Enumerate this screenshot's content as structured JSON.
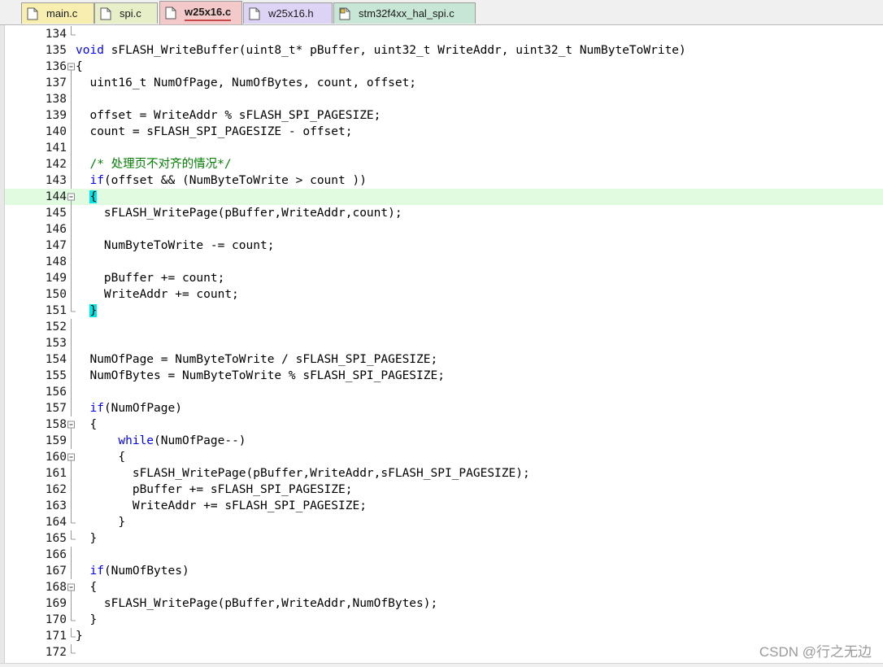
{
  "tabs": [
    {
      "label": "main.c",
      "color": "#f7eeb0",
      "icon": "c-file-icon",
      "active": false
    },
    {
      "label": "spi.c",
      "color": "#e6efc8",
      "icon": "c-file-icon",
      "active": false
    },
    {
      "label": "w25x16.c",
      "color": "#f4c9c9",
      "icon": "c-file-icon",
      "active": true
    },
    {
      "label": "w25x16.h",
      "color": "#ddd4f5",
      "icon": "h-file-icon",
      "active": false
    },
    {
      "label": "stm32f4xx_hal_spi.c",
      "color": "#c8e6d6",
      "icon": "c-file-key-icon",
      "active": false
    }
  ],
  "highlight_color": "#e0fbe0",
  "brace_match_color": "#00e5e5",
  "lines": [
    {
      "n": "134",
      "fold": "end",
      "segs": [
        {
          "t": ""
        }
      ]
    },
    {
      "n": "135",
      "fold": "",
      "segs": [
        {
          "t": "void",
          "c": "kw"
        },
        {
          "t": " sFLASH_WriteBuffer(uint8_t* pBuffer, uint32_t WriteAddr, uint32_t NumByteToWrite)"
        }
      ]
    },
    {
      "n": "136",
      "fold": "box",
      "segs": [
        {
          "t": "{"
        }
      ]
    },
    {
      "n": "137",
      "fold": "bar",
      "segs": [
        {
          "t": "  uint16_t NumOfPage, NumOfBytes, count, offset;"
        }
      ]
    },
    {
      "n": "138",
      "fold": "bar",
      "segs": [
        {
          "t": ""
        }
      ]
    },
    {
      "n": "139",
      "fold": "bar",
      "segs": [
        {
          "t": "  offset = WriteAddr % sFLASH_SPI_PAGESIZE;"
        }
      ]
    },
    {
      "n": "140",
      "fold": "bar",
      "segs": [
        {
          "t": "  count = sFLASH_SPI_PAGESIZE - offset;"
        }
      ]
    },
    {
      "n": "141",
      "fold": "bar",
      "segs": [
        {
          "t": ""
        }
      ]
    },
    {
      "n": "142",
      "fold": "bar",
      "segs": [
        {
          "t": "  "
        },
        {
          "t": "/* 处理页不对齐的情况*/",
          "c": "cm"
        }
      ]
    },
    {
      "n": "143",
      "fold": "bar",
      "segs": [
        {
          "t": "  "
        },
        {
          "t": "if",
          "c": "kw"
        },
        {
          "t": "(offset && (NumByteToWrite > count ))"
        }
      ]
    },
    {
      "n": "144",
      "fold": "box",
      "hl": true,
      "segs": [
        {
          "t": "  "
        },
        {
          "t": "{",
          "c": "br"
        }
      ]
    },
    {
      "n": "145",
      "fold": "bar",
      "segs": [
        {
          "t": "    sFLASH_WritePage(pBuffer,WriteAddr,count);"
        }
      ]
    },
    {
      "n": "146",
      "fold": "bar",
      "segs": [
        {
          "t": ""
        }
      ]
    },
    {
      "n": "147",
      "fold": "bar",
      "segs": [
        {
          "t": "    NumByteToWrite -= count;"
        }
      ]
    },
    {
      "n": "148",
      "fold": "bar",
      "segs": [
        {
          "t": ""
        }
      ]
    },
    {
      "n": "149",
      "fold": "bar",
      "segs": [
        {
          "t": "    pBuffer += count;"
        }
      ]
    },
    {
      "n": "150",
      "fold": "bar",
      "segs": [
        {
          "t": "    WriteAddr += count;"
        }
      ]
    },
    {
      "n": "151",
      "fold": "end",
      "segs": [
        {
          "t": "  "
        },
        {
          "t": "}",
          "c": "br"
        }
      ]
    },
    {
      "n": "152",
      "fold": "bar",
      "segs": [
        {
          "t": ""
        }
      ]
    },
    {
      "n": "153",
      "fold": "bar",
      "segs": [
        {
          "t": ""
        }
      ]
    },
    {
      "n": "154",
      "fold": "bar",
      "segs": [
        {
          "t": "  NumOfPage = NumByteToWrite / sFLASH_SPI_PAGESIZE;"
        }
      ]
    },
    {
      "n": "155",
      "fold": "bar",
      "segs": [
        {
          "t": "  NumOfBytes = NumByteToWrite % sFLASH_SPI_PAGESIZE;"
        }
      ]
    },
    {
      "n": "156",
      "fold": "bar",
      "segs": [
        {
          "t": ""
        }
      ]
    },
    {
      "n": "157",
      "fold": "bar",
      "segs": [
        {
          "t": "  "
        },
        {
          "t": "if",
          "c": "kw"
        },
        {
          "t": "(NumOfPage)"
        }
      ]
    },
    {
      "n": "158",
      "fold": "box",
      "segs": [
        {
          "t": "  {"
        }
      ]
    },
    {
      "n": "159",
      "fold": "bar",
      "segs": [
        {
          "t": "      "
        },
        {
          "t": "while",
          "c": "kw"
        },
        {
          "t": "(NumOfPage--)"
        }
      ]
    },
    {
      "n": "160",
      "fold": "box",
      "segs": [
        {
          "t": "      {"
        }
      ]
    },
    {
      "n": "161",
      "fold": "bar",
      "segs": [
        {
          "t": "        sFLASH_WritePage(pBuffer,WriteAddr,sFLASH_SPI_PAGESIZE);"
        }
      ]
    },
    {
      "n": "162",
      "fold": "bar",
      "segs": [
        {
          "t": "        pBuffer += sFLASH_SPI_PAGESIZE;"
        }
      ]
    },
    {
      "n": "163",
      "fold": "bar",
      "segs": [
        {
          "t": "        WriteAddr += sFLASH_SPI_PAGESIZE;"
        }
      ]
    },
    {
      "n": "164",
      "fold": "end",
      "segs": [
        {
          "t": "      }"
        }
      ]
    },
    {
      "n": "165",
      "fold": "end",
      "segs": [
        {
          "t": "  }"
        }
      ]
    },
    {
      "n": "166",
      "fold": "bar",
      "segs": [
        {
          "t": ""
        }
      ]
    },
    {
      "n": "167",
      "fold": "bar",
      "segs": [
        {
          "t": "  "
        },
        {
          "t": "if",
          "c": "kw"
        },
        {
          "t": "(NumOfBytes)"
        }
      ]
    },
    {
      "n": "168",
      "fold": "box",
      "segs": [
        {
          "t": "  {"
        }
      ]
    },
    {
      "n": "169",
      "fold": "bar",
      "segs": [
        {
          "t": "    sFLASH_WritePage(pBuffer,WriteAddr,NumOfBytes);"
        }
      ]
    },
    {
      "n": "170",
      "fold": "end",
      "segs": [
        {
          "t": "  }"
        }
      ]
    },
    {
      "n": "171",
      "fold": "end",
      "segs": [
        {
          "t": "}"
        }
      ]
    },
    {
      "n": "172",
      "fold": "end",
      "segs": [
        {
          "t": ""
        }
      ]
    }
  ],
  "watermark": "CSDN @行之无边"
}
